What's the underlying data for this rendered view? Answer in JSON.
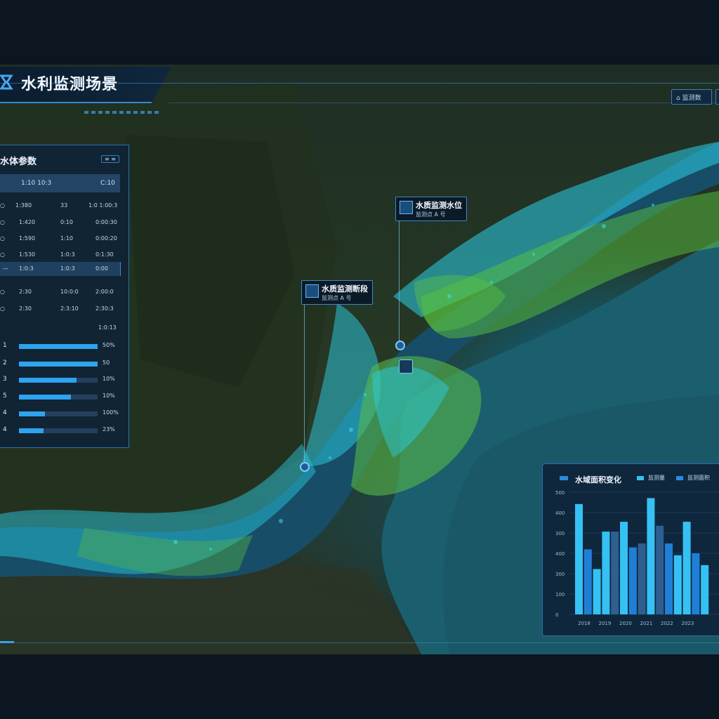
{
  "header": {
    "title": "水利监测场景",
    "top_buttons": [
      "⌂ 监测数",
      ""
    ]
  },
  "left_panel": {
    "title": "水体参数",
    "badge": "≡ ≡",
    "header_cols": [
      "1:10 10:3",
      "",
      "C:10"
    ],
    "rows": [
      [
        "○",
        "1:380",
        "33",
        "1:0 1:00:3"
      ],
      [
        "○",
        "1:420",
        "0:10",
        "0:00:30"
      ],
      [
        "○",
        "1:590",
        "1:10",
        "0:00:20"
      ],
      [
        "○",
        "1:530",
        "1:0:3",
        "0:1:30"
      ],
      [
        "—",
        "1:0:3",
        "1:0:3",
        "0:00"
      ],
      [
        "○",
        "2:30",
        "10:0:0",
        "2:00:0"
      ],
      [
        "○",
        "2:30",
        "2:3:10",
        "2:30:3"
      ]
    ],
    "bars_header": "1:0:13",
    "bars": [
      {
        "idx": "1",
        "value": 1.0,
        "label": "50%"
      },
      {
        "idx": "2",
        "value": 1.0,
        "label": "50"
      },
      {
        "idx": "3",
        "value": 0.73,
        "label": "10%"
      },
      {
        "idx": "5",
        "value": 0.66,
        "label": "10%"
      },
      {
        "idx": "4",
        "value": 0.33,
        "label": "100%"
      },
      {
        "idx": "4",
        "value": 0.31,
        "label": "23%"
      }
    ]
  },
  "map_labels": [
    {
      "title": "水质监测水位",
      "sub": "监测点 A 号",
      "icon": "monitor-icon"
    },
    {
      "title": "水质监测断段",
      "sub": "监测点 A 号",
      "icon": "monitor-icon"
    }
  ],
  "chart_panel": {
    "title": "水域面积变化",
    "legends": [
      "监测量",
      "监测面积"
    ]
  },
  "chart_data": {
    "type": "bar",
    "title": "水域面积变化",
    "yticks": [
      "500",
      "400",
      "300",
      "400",
      "300",
      "100",
      "0"
    ],
    "xticks": [
      "2018",
      "2019",
      "2020",
      "2021",
      "2022",
      "2023"
    ],
    "series": [
      {
        "name": "监测量",
        "color": "#35c1f4"
      },
      {
        "name": "监测面积",
        "color": "#1f7fd6"
      }
    ],
    "bars": [
      {
        "v": 560,
        "c": "#35c1f4"
      },
      {
        "v": 330,
        "c": "#1f7fd6"
      },
      {
        "v": 230,
        "c": "#35c1f4"
      },
      {
        "v": 420,
        "c": "#35c1f4"
      },
      {
        "v": 420,
        "c": "#2f5f90"
      },
      {
        "v": 470,
        "c": "#35c1f4"
      },
      {
        "v": 340,
        "c": "#1f7fd6"
      },
      {
        "v": 360,
        "c": "#2f5f90"
      },
      {
        "v": 590,
        "c": "#35c1f4"
      },
      {
        "v": 450,
        "c": "#2f5f90"
      },
      {
        "v": 360,
        "c": "#1f7fd6"
      },
      {
        "v": 300,
        "c": "#35c1f4"
      },
      {
        "v": 470,
        "c": "#35c1f4"
      },
      {
        "v": 310,
        "c": "#1f7fd6"
      },
      {
        "v": 250,
        "c": "#35c1f4"
      }
    ],
    "ylim": [
      0,
      620
    ]
  }
}
